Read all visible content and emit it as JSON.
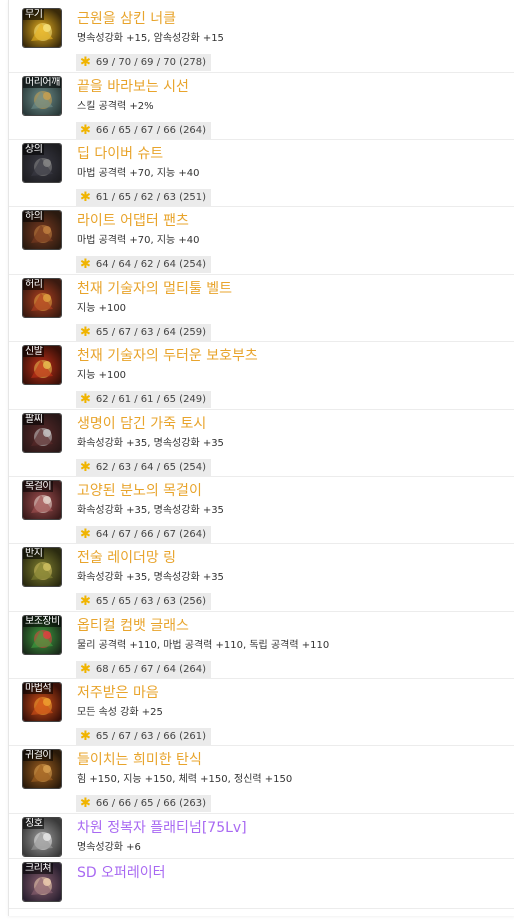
{
  "items": [
    {
      "slot": "무기",
      "name": "근원을 삼킨 너클",
      "stat": "명속성강화 +15, 암속성강화 +15",
      "score": "69 / 70 / 69 / 70 (278)",
      "bg": "#3a2a0a",
      "glow": "#e6b020",
      "accent": "#f7e27a"
    },
    {
      "slot": "머리어깨",
      "name": "끝을 바라보는 시선",
      "stat": "스킬 공격력 +2%",
      "score": "66 / 65 / 67 / 66 (264)",
      "bg": "#2a3a3a",
      "glow": "#6e8e8a",
      "accent": "#c8a050"
    },
    {
      "slot": "상의",
      "name": "딥 다이버 슈트",
      "stat": "마법 공격력 +70, 지능 +40",
      "score": "61 / 65 / 62 / 63 (251)",
      "bg": "#1e1e22",
      "glow": "#3a3a44",
      "accent": "#888"
    },
    {
      "slot": "하의",
      "name": "라이트 어댑터 팬츠",
      "stat": "마법 공격력 +70, 지능 +40",
      "score": "64 / 64 / 62 / 64 (254)",
      "bg": "#2a1a10",
      "glow": "#7a3a20",
      "accent": "#c08040"
    },
    {
      "slot": "허리",
      "name": "천재 기술자의 멀티툴 벨트",
      "stat": "지능 +100",
      "score": "65 / 67 / 63 / 64 (259)",
      "bg": "#3a1a10",
      "glow": "#b04020",
      "accent": "#e0a040"
    },
    {
      "slot": "신발",
      "name": "천재 기술자의 두터운 보호부츠",
      "stat": "지능 +100",
      "score": "62 / 61 / 61 / 65 (249)",
      "bg": "#3a1008",
      "glow": "#c03018",
      "accent": "#e8c050"
    },
    {
      "slot": "팔찌",
      "name": "생명이 담긴 가죽 토시",
      "stat": "화속성강화 +35, 명속성강화 +35",
      "score": "62 / 63 / 64 / 65 (254)",
      "bg": "#2a1818",
      "glow": "#5a2a2a",
      "accent": "#c8c8c8"
    },
    {
      "slot": "목걸이",
      "name": "고양된 분노의 목걸이",
      "stat": "화속성강화 +35, 명속성강화 +35",
      "score": "64 / 67 / 66 / 67 (264)",
      "bg": "#3a1a1a",
      "glow": "#a05050",
      "accent": "#e8d8d0"
    },
    {
      "slot": "반지",
      "name": "전술 레이더망 링",
      "stat": "화속성강화 +35, 명속성강화 +35",
      "score": "65 / 65 / 63 / 63 (256)",
      "bg": "#2a2a10",
      "glow": "#808030",
      "accent": "#d0c060"
    },
    {
      "slot": "보조장비",
      "name": "옵티컬 컴뱃 글래스",
      "stat": "물리 공격력 +110, 마법 공격력 +110, 독립 공격력 +110",
      "score": "68 / 65 / 67 / 64 (264)",
      "bg": "#1a2a1a",
      "glow": "#40a040",
      "accent": "#e04040"
    },
    {
      "slot": "마법석",
      "name": "저주받은 마음",
      "stat": "모든 속성 강화 +25",
      "score": "65 / 67 / 63 / 66 (261)",
      "bg": "#3a1008",
      "glow": "#d05018",
      "accent": "#f0a030"
    },
    {
      "slot": "귀걸이",
      "name": "들이치는 희미한 탄식",
      "stat": "힘 +150, 지능 +150, 체력 +150, 정신력 +150",
      "score": "66 / 66 / 65 / 66 (263)",
      "bg": "#2a1a0a",
      "glow": "#a06020",
      "accent": "#d8a050"
    },
    {
      "slot": "칭호",
      "name": "차원 정복자 플래티넘[75Lv]",
      "stat": "명속성강화 +6",
      "score": "",
      "bg": "#3a3a3a",
      "glow": "#9a9a9a",
      "accent": "#e8e8e8",
      "epic": true
    },
    {
      "slot": "크리쳐",
      "name": "SD 오퍼레이터",
      "stat": "",
      "score": "",
      "bg": "#2a2030",
      "glow": "#8a6070",
      "accent": "#f0d0b0",
      "epic": true
    }
  ]
}
